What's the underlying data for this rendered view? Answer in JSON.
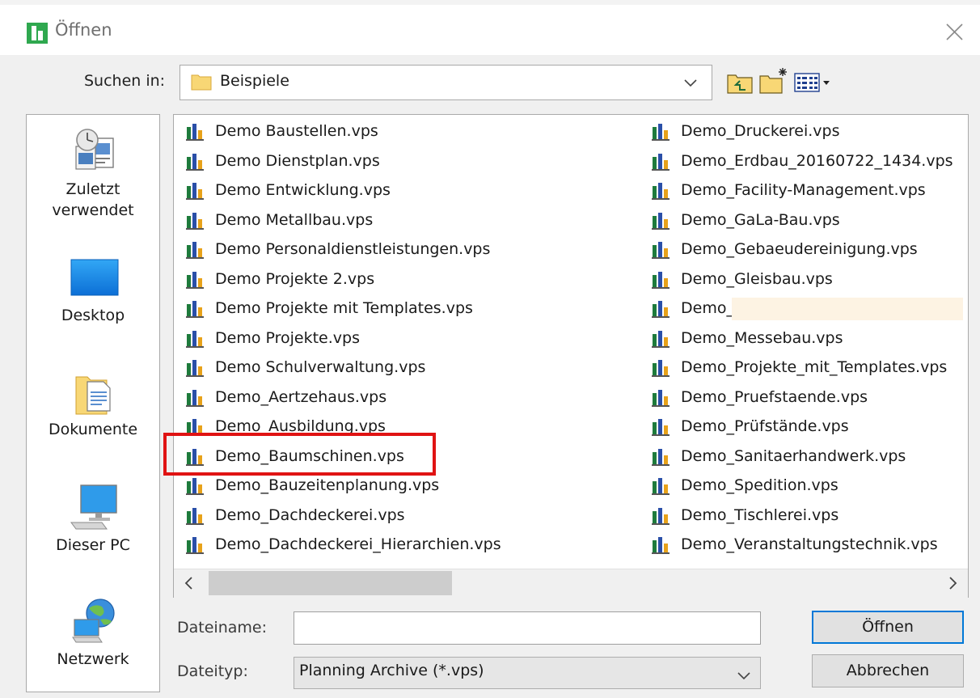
{
  "window": {
    "title": "Öffnen"
  },
  "lookin": {
    "label": "Suchen in:",
    "value": "Beispiele"
  },
  "places": [
    {
      "label": "Zuletzt verwendet",
      "icon": "recent-places-icon"
    },
    {
      "label": "Desktop",
      "icon": "desktop-icon"
    },
    {
      "label": "Dokumente",
      "icon": "documents-icon"
    },
    {
      "label": "Dieser PC",
      "icon": "computer-icon"
    },
    {
      "label": "Netzwerk",
      "icon": "network-icon"
    }
  ],
  "files": {
    "column1": [
      "Demo Baustellen.vps",
      "Demo Dienstplan.vps",
      "Demo Entwicklung.vps",
      "Demo Metallbau.vps",
      "Demo Personaldienstleistungen.vps",
      "Demo Projekte 2.vps",
      "Demo Projekte mit Templates.vps",
      "Demo Projekte.vps",
      "Demo Schulverwaltung.vps",
      "Demo_Aertzehaus.vps",
      "Demo_Ausbildung.vps",
      "Demo_Baumschinen.vps",
      "Demo_Bauzeitenplanung.vps",
      "Demo_Dachdeckerei.vps",
      "Demo_Dachdeckerei_Hierarchien.vps"
    ],
    "column2": [
      "Demo_Druckerei.vps",
      "Demo_Erdbau_20160722_1434.vps",
      "Demo_Facility-Management.vps",
      "Demo_GaLa-Bau.vps",
      "Demo_Gebaeudereinigung.vps",
      "Demo_Gleisbau.vps",
      "Demo_",
      "Demo_Messebau.vps",
      "Demo_Projekte_mit_Templates.vps",
      "Demo_Pruefstaende.vps",
      "Demo_Prüfstände.vps",
      "Demo_Sanitaerhandwerk.vps",
      "Demo_Spedition.vps",
      "Demo_Tischlerei.vps",
      "Demo_Veranstaltungstechnik.vps"
    ]
  },
  "filename": {
    "label": "Dateiname:",
    "value": ""
  },
  "filetype": {
    "label": "Dateityp:",
    "value": "Planning Archive (*.vps)"
  },
  "buttons": {
    "open": "Öffnen",
    "cancel": "Abbrechen"
  },
  "colors": {
    "highlight": "#e01313",
    "focus": "#0078d7",
    "panel": "#f0f0f0"
  }
}
